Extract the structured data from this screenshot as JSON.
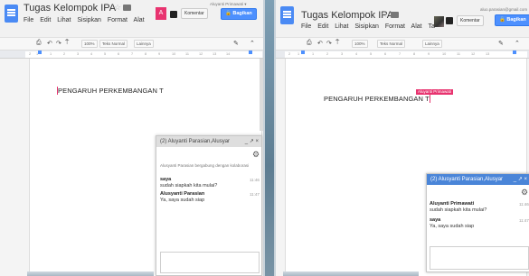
{
  "left": {
    "title": "Tugas Kelompok IPA",
    "menu": [
      "File",
      "Edit",
      "Lihat",
      "Sisipkan",
      "Format",
      "Alat"
    ],
    "email": "Aluyanti Primawati ▾",
    "avatar_letter": "A",
    "komentar": "Komentar",
    "bagikan": "Bagikan",
    "toolbar": {
      "zoom": "100%",
      "style": "Teks Normal",
      "more": "Lainnya"
    },
    "ruler": [
      "2",
      "1",
      "1",
      "2",
      "3",
      "4",
      "5",
      "6",
      "7",
      "8",
      "9",
      "10",
      "11",
      "12",
      "13",
      "14"
    ],
    "doc_text": "PENGARUH PERKEMBANGAN T",
    "chat": {
      "title": "(2) Aluyanti Parasian,Alusyar",
      "controls": "_ ↗ ×",
      "system": "Alusyanti Parasian bergabung dengan kolaborasi",
      "messages": [
        {
          "sender": "saya",
          "text": "sudah siapkah kita mulai?",
          "time": "11:46"
        },
        {
          "sender": "Alusyanti Parasian",
          "text": "Ya, saya sudah siap",
          "time": "11:47"
        }
      ]
    }
  },
  "right": {
    "title": "Tugas Kelompok IPA",
    "menu": [
      "File",
      "Edit",
      "Lihat",
      "Sisipkan",
      "Format",
      "Alat",
      "Ta"
    ],
    "email": "aluo.parasian@gmail.com",
    "komentar": "Komentar",
    "bagikan": "Bagikan",
    "toolbar": {
      "zoom": "100%",
      "style": "Teks Normal",
      "more": "Lainnya"
    },
    "ruler": [
      "2",
      "1",
      "1",
      "2",
      "3",
      "4",
      "5",
      "6",
      "7",
      "8",
      "9",
      "10",
      "11",
      "12",
      "13"
    ],
    "doc_text": "PENGARUH PERKEMBANGAN T",
    "cursor_flag": "Aluyanti Primawati",
    "chat": {
      "title": "(2) Alusyanti Parasian,Alusyar",
      "controls": "_ ↗ ×",
      "messages": [
        {
          "sender": "Aluyanti Primawati",
          "text": "sudah siapkah kita mulai?",
          "time": "11:46"
        },
        {
          "sender": "saya",
          "text": "Ya, saya sudah siap",
          "time": "11:47"
        }
      ]
    }
  },
  "colors": {
    "accent_blue": "#4d90fe",
    "collab_pink": "#e8336f",
    "chat_header_left": "#dedede",
    "chat_header_right": "#4a85d8"
  }
}
